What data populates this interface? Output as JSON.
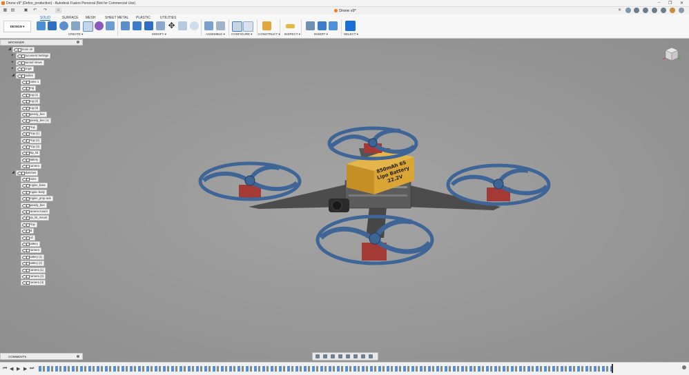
{
  "window": {
    "title": "Drone v9* (Defno_production) - Autodesk Fusion Personal (Not for Commercial Use)",
    "doc_tab": "Drone v9*"
  },
  "ribbon": {
    "tabs": [
      "SOLID",
      "SURFACE",
      "MESH",
      "SHEET METAL",
      "PLASTIC",
      "UTILITIES"
    ],
    "active_tab": "SOLID",
    "workspace": "DESIGN ▾",
    "groups": [
      "CREATE ▾",
      "MODIFY ▾",
      "ASSEMBLE ▾",
      "CONFIGURE ▾",
      "CONSTRUCT ▾",
      "INSPECT ▾",
      "INSERT ▾",
      "SELECT ▾"
    ]
  },
  "browser": {
    "header": "BROWSER",
    "root": "Drone v9",
    "top_items": [
      "Document Settings",
      "Named Views",
      "Origin",
      "Bodies"
    ],
    "bodies": [
      "frame 1",
      "eng",
      "eng (1)",
      "eng (2)",
      "eng (3)",
      "speedy_bee",
      "speedy_bee (1)",
      "Prop",
      "Prop (1)",
      "Prop (2)",
      "Prop (3)",
      "Top_lid",
      "Battery",
      "Camera"
    ],
    "sketches_label": "Sketches",
    "sketches": [
      "frame",
      "engine_base",
      "engine body",
      "engine_prop axis",
      "speedy_bee",
      "camera mount",
      "top_lid_mount",
      "Prop",
      "lid",
      "Lid",
      "battery",
      "Camera",
      "battery (1)",
      "battery (2)",
      "Camera (1)",
      "Camera (2)",
      "Camera (3)"
    ]
  },
  "battery_label": {
    "line1": "850mAh 6S",
    "line2": "Lipo Battery",
    "line3": "22.2V"
  },
  "comments": {
    "label": "COMMENTS"
  },
  "colors": {
    "viewport_bg": "#9a9a9a",
    "prop_blue": "#3f6597",
    "motor_red": "#a33a35",
    "battery_gold": "#d9a534",
    "frame_dark": "#4c4c4c",
    "accent": "#0a64c8"
  }
}
